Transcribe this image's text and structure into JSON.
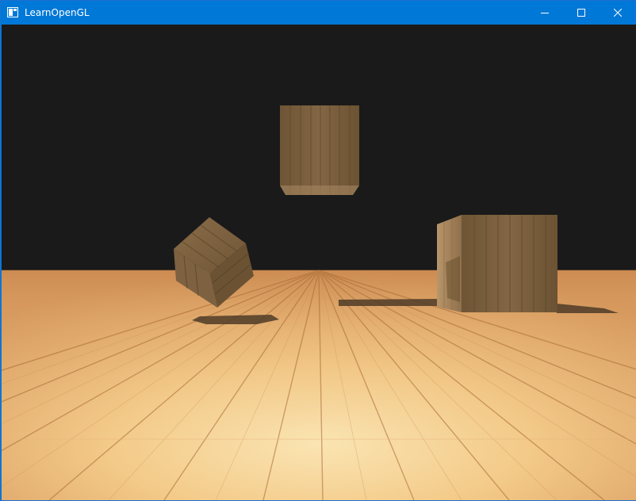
{
  "window": {
    "title": "LearnOpenGL",
    "icon": "app-window-icon",
    "controls": [
      "minimize-icon",
      "maximize-icon",
      "close-icon"
    ]
  },
  "colors": {
    "titlebar": "#0078d7",
    "clear_color": "#1a1a1a",
    "floor_light": "#f7cf96",
    "floor_dark": "#d08c4e",
    "crate": "#7a5d3c",
    "shadow": "#5a4630"
  },
  "scene": {
    "objects": [
      "wood-floor",
      "floating-crate-top",
      "rotated-crate",
      "floor-crate",
      "crate-shadows"
    ]
  }
}
